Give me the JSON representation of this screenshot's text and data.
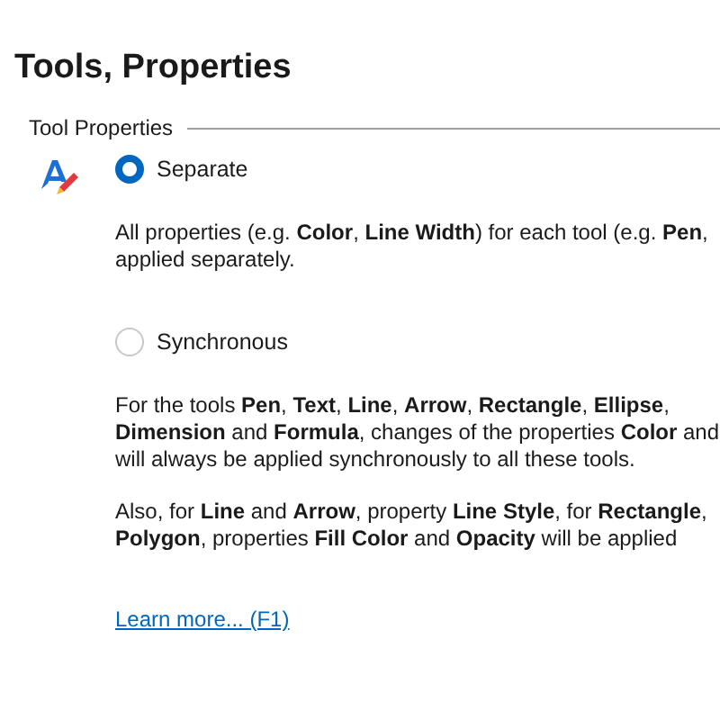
{
  "page": {
    "title": "Tools, Properties"
  },
  "group": {
    "label": "Tool Properties"
  },
  "options": [
    {
      "label": "Separate",
      "selected": true,
      "paragraphs": [
        [
          "All properties (e.g. **Color**, **Line Width**) for each tool (e.g. **Pen**,",
          "applied separately."
        ]
      ]
    },
    {
      "label": "Synchronous",
      "selected": false,
      "paragraphs": [
        [
          "For the tools **Pen**, **Text**, **Line**, **Arrow**, **Rectangle**, **Ellipse**,",
          "**Dimension** and **Formula**, changes of the properties **Color** and",
          "will always be applied synchronously to all these tools."
        ],
        [
          "Also, for **Line** and **Arrow**, property **Line Style**, for **Rectangle**,",
          "**Polygon**, properties **Fill Color** and **Opacity** will be applied"
        ]
      ]
    }
  ],
  "link": {
    "text": "Learn more... (F1)"
  }
}
